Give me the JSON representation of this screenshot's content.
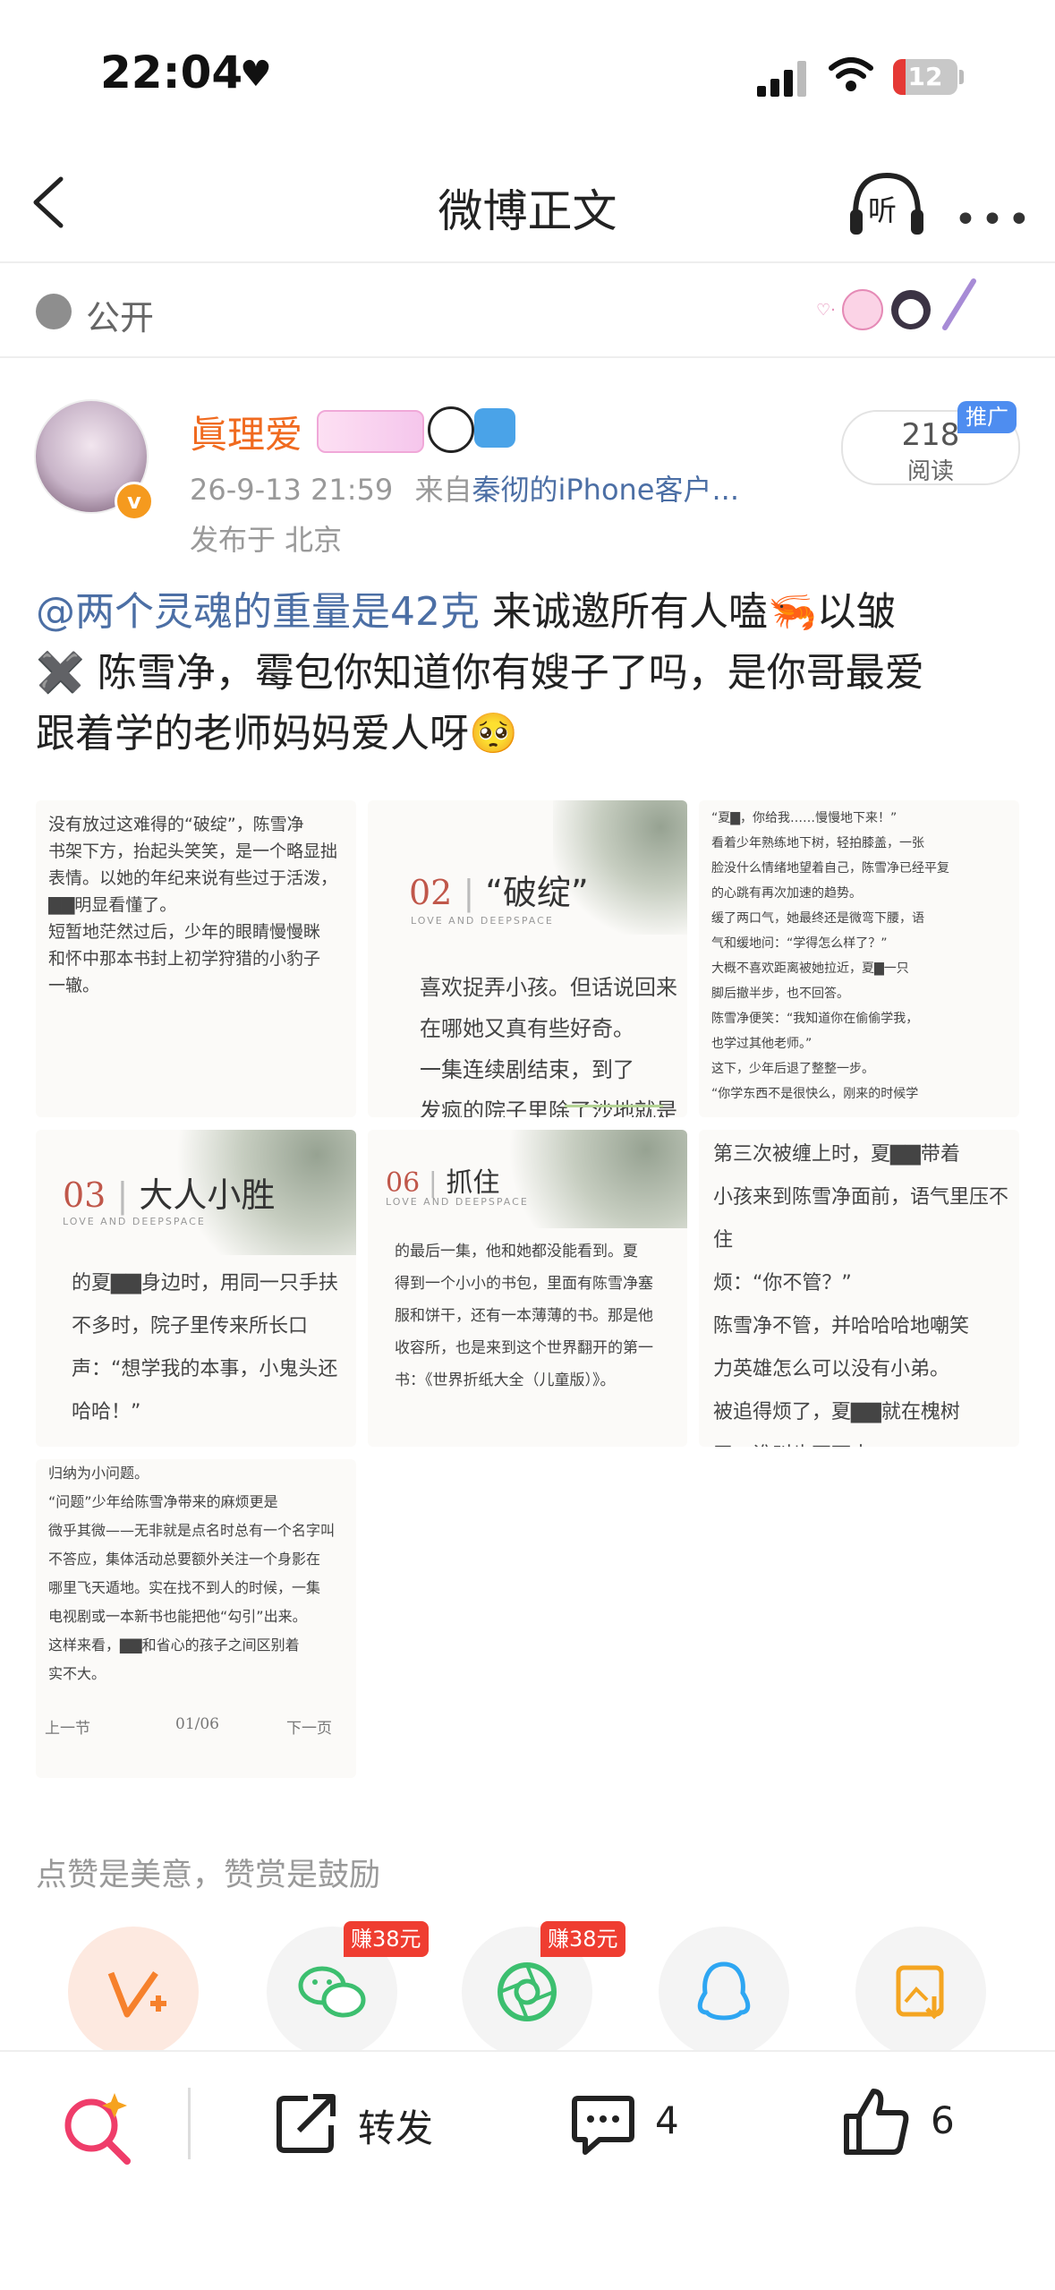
{
  "status_bar": {
    "time": "22:04",
    "battery": "12"
  },
  "nav": {
    "title": "微博正文",
    "listen_label": "听"
  },
  "visibility": {
    "label": "公开"
  },
  "author": {
    "name": "眞理爱",
    "verified_badge": "v",
    "timestamp": "26-9-13 21:59",
    "source_prefix": "来自",
    "source": "秦彻的iPhone客户...",
    "location": "发布于 北京",
    "reads_count": "218",
    "reads_label": "阅读",
    "promo_label": "推广"
  },
  "post": {
    "mention": "@两个灵魂的重量是42克",
    "line1_rest": " 来诚邀所有人嗑🦐以皱",
    "line2": "✖️ 陈雪净，霉包你知道你有嫂子了吗，是你哥最爱",
    "line3": "跟着学的老师妈妈爱人呀🥺"
  },
  "images": [
    {
      "text": "没有放过这难得的“破绽”，陈雪净\n书架下方，抬起头笑笑，是一个略显拙\n表情。以她的年纪来说有些过于活泼，\n▇▇明显看懂了。\n短暂地茫然过后，少年的眼睛慢慢眯\n和怀中那本书封上初学狩猎的小豹子\n一辙。"
    },
    {
      "num": "02",
      "title": "“破绽”",
      "tag": "LOVE AND DEEPSPACE",
      "text": "喜欢捉弄小孩。但话说回来\n在哪她又真有些好奇。\n       一集连续剧结束，到了\n发疯的院子里除了沙地就是"
    },
    {
      "text": "“夏▇，你给我……慢慢地下来！”\n看着少年熟练地下树，轻拍膝盖，一张\n脸没什么情绪地望着自己，陈雪净已经平复\n的心跳有再次加速的趋势。\n缓了两口气，她最终还是微弯下腰，语\n气和缓地问：“学得怎么样了？”\n大概不喜欢距离被她拉近，夏▇一只\n脚后撤半步，也不回答。\n陈雪净便笑：“我知道你在偷偷学我，\n也学过其他老师。”\n这下，少年后退了整整一步。\n“你学东西不是很快么，刚来的时候学"
    },
    {
      "num": "03",
      "title": "大人小胜",
      "tag": "LOVE AND DEEPSPACE",
      "text": "的夏▇▇身边时，用同一只手扶\n不多时，院子里传来所长口\n声：“想学我的本事，小鬼头还\n哈哈！”"
    },
    {
      "num": "06",
      "title": "抓住",
      "tag": "LOVE AND DEEPSPACE",
      "text": "的最后一集，他和她都没能看到。夏\n得到一个小小的书包，里面有陈雪净塞\n服和饼干，还有一本薄薄的书。那是他\n收容所，也是来到这个世界翻开的第一\n书：《世界折纸大全（儿童版）》。"
    },
    {
      "text": "第三次被缠上时，夏▇▇带着\n小孩来到陈雪净面前，语气里压不住\n烦：“你不管？”\n陈雪净不管，并哈哈哈地嘲笑\n力英雄怎么可以没有小弟。\n被追得烦了，夏▇▇就在槐树\n天，谁叫也不下去。"
    },
    {
      "text": "归纳为小问题。\n“问题”少年给陈雪净带来的麻烦更是\n微乎其微——无非就是点名时总有一个名字叫\n不答应，集体活动总要额外关注一个身影在\n哪里飞天遁地。实在找不到人的时候，一集\n电视剧或一本新书也能把他“勾引”出来。\n这样来看，▇▇和省心的孩子之间区别着\n实不大。",
      "pager": {
        "prev": "上一节",
        "page": "01/06",
        "next": "下一页"
      }
    }
  ],
  "support_text": "点赞是美意，赞赏是鼓励",
  "share": {
    "wechat_reward": "赚38元",
    "moments_reward": "赚38元"
  },
  "bottom_bar": {
    "repost_label": "转发",
    "comment_count": "4",
    "like_count": "6"
  },
  "colors": {
    "accent_orange": "#f06a1f",
    "link_blue": "#4c6fa5",
    "reward_red": "#ef3d31",
    "wechat_green": "#3cbf6f",
    "qq_blue": "#2ea6f2",
    "save_orange": "#f4a521"
  },
  "icons": [
    "back-chevron-icon",
    "headphones-icon",
    "more-icon",
    "globe-icon",
    "search-sparkle-icon",
    "repost-icon",
    "comment-icon",
    "like-icon",
    "wechat-icon",
    "moments-icon",
    "qq-icon",
    "save-image-icon",
    "reward-v-icon"
  ]
}
